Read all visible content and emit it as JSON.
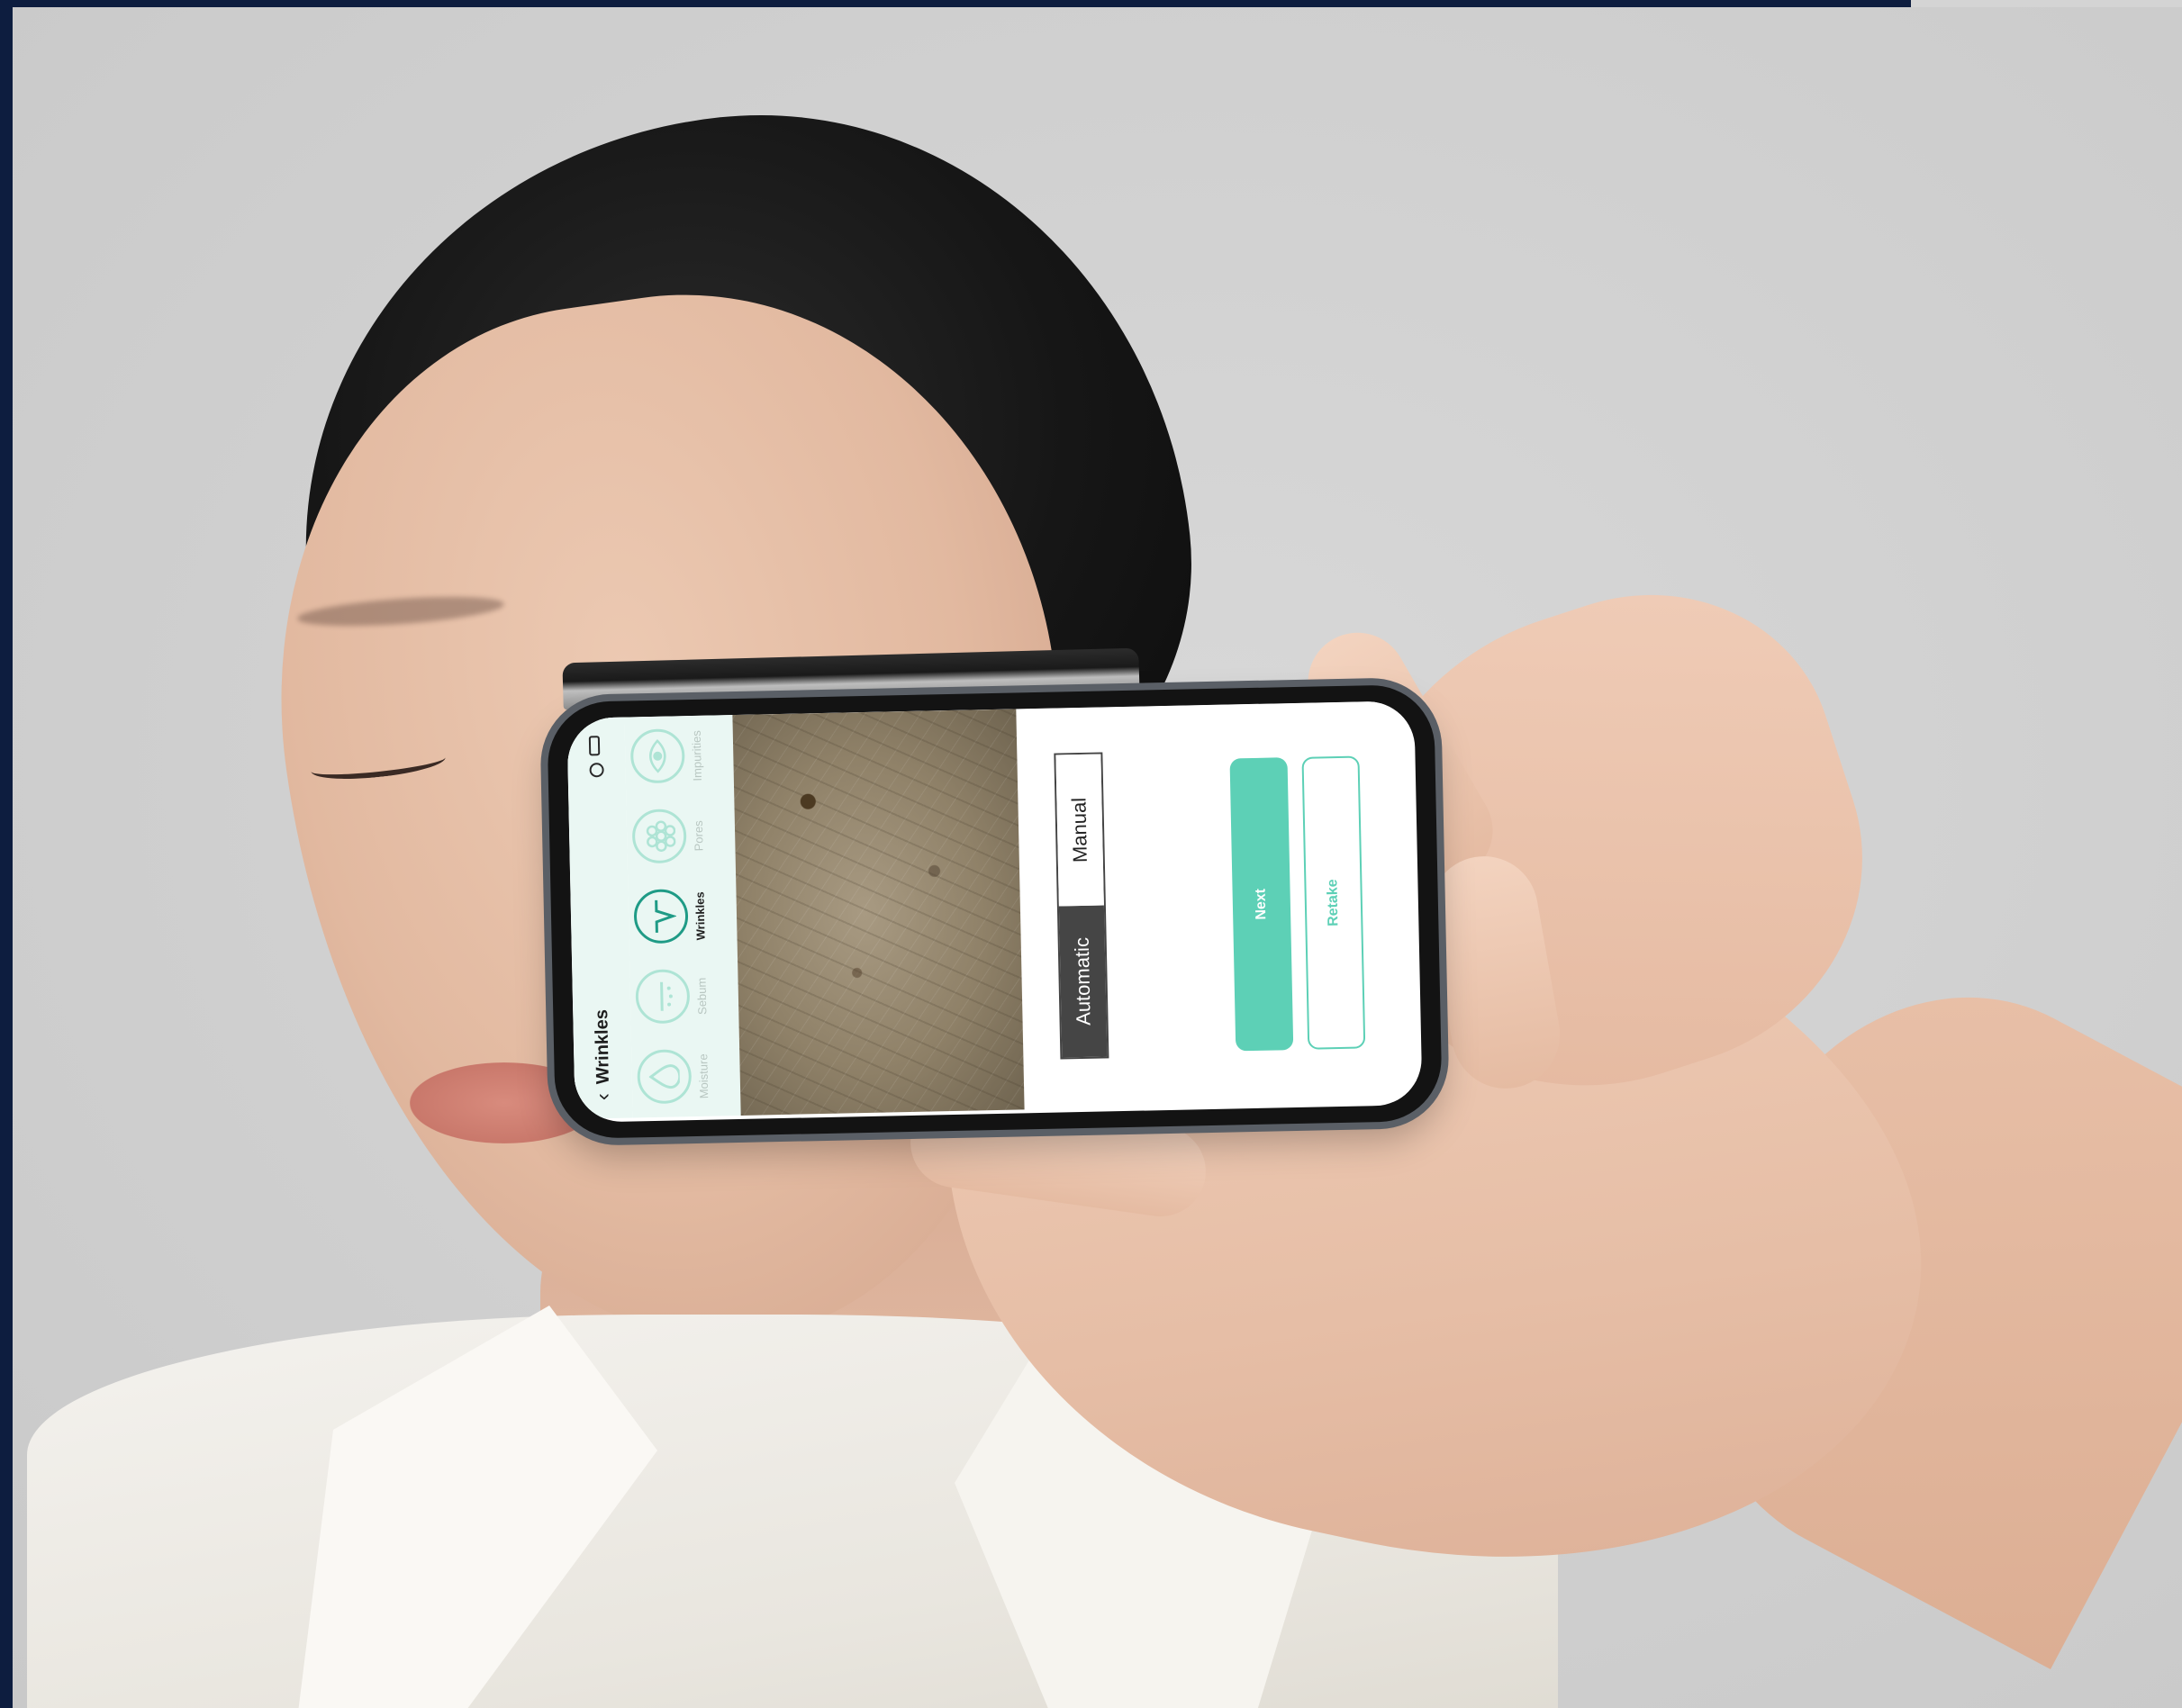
{
  "app": {
    "header": {
      "back_glyph": "‹",
      "title": "Wrinkles"
    },
    "tabs": [
      {
        "label": "Moisture",
        "icon": "drop-icon",
        "active": false
      },
      {
        "label": "Sebum",
        "icon": "sebum-icon",
        "active": false
      },
      {
        "label": "Wrinkles",
        "icon": "wrinkle-icon",
        "active": true
      },
      {
        "label": "Pores",
        "icon": "pores-icon",
        "active": false
      },
      {
        "label": "Impurities",
        "icon": "eye-icon",
        "active": false
      }
    ],
    "mode": {
      "automatic": "Automatic",
      "manual": "Manual",
      "selected": "Automatic"
    },
    "buttons": {
      "next": "Next",
      "retake": "Retake"
    },
    "colors": {
      "accent": "#5dd0b6",
      "header_bg": "#eaf7f3",
      "selected_mode": "#454545"
    }
  }
}
